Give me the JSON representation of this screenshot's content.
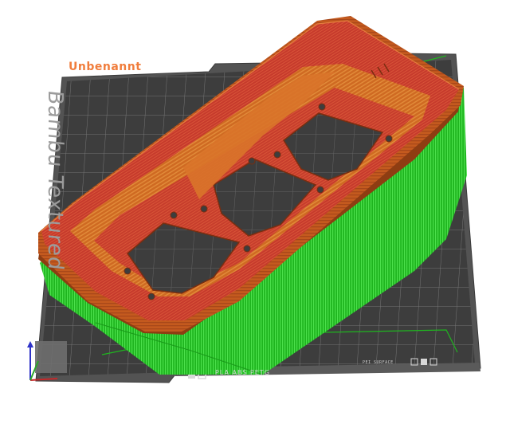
{
  "plate": {
    "name": "Unbenannt",
    "brand_text": "Bambu Textured",
    "filament_types": "PLA  ABS  PETG",
    "surface_label": "PEI SURFACE"
  },
  "colors": {
    "plate_name": "#f07d3c",
    "plate_surface": "#3d3d3d",
    "plate_frame": "#505050",
    "grid": "#7b7b7b",
    "support": "#22c722",
    "part_wall": "#c0561c",
    "part_top": "#c8342a",
    "part_inner": "#d46f24",
    "axis_x": "#c4282a",
    "axis_y": "#2da52d",
    "axis_z": "#2e32c8"
  },
  "icons": [
    "bambu-logo-icon",
    "axis-gizmo-icon",
    "plate-corner-icons"
  ]
}
